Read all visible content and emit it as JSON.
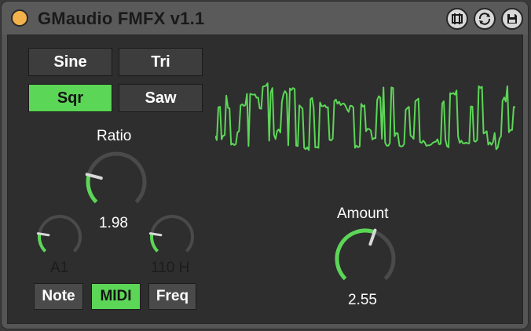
{
  "header": {
    "title": "GMaudio FMFX v1.1",
    "icons": [
      "power-dot",
      "hot-swap-icon",
      "refresh-icon",
      "save-icon"
    ]
  },
  "waveforms": {
    "sine": "Sine",
    "tri": "Tri",
    "sqr": "Sqr",
    "saw": "Saw",
    "selected": "Sqr"
  },
  "ratio": {
    "label": "Ratio",
    "value": "1.98",
    "fraction": 0.22
  },
  "note_knob": {
    "value": "A1",
    "fraction": 0.2
  },
  "freq_knob": {
    "value": "110 H",
    "fraction": 0.2
  },
  "mode": {
    "note": "Note",
    "midi": "MIDI",
    "freq": "Freq",
    "selected": "MIDI"
  },
  "amount": {
    "label": "Amount",
    "value": "2.55",
    "fraction": 0.57
  },
  "colors": {
    "accent": "#5cd657",
    "power": "#f3b24b",
    "panel": "#2e2e2e",
    "chrome": "#555555",
    "track": "#4a4a4a"
  }
}
